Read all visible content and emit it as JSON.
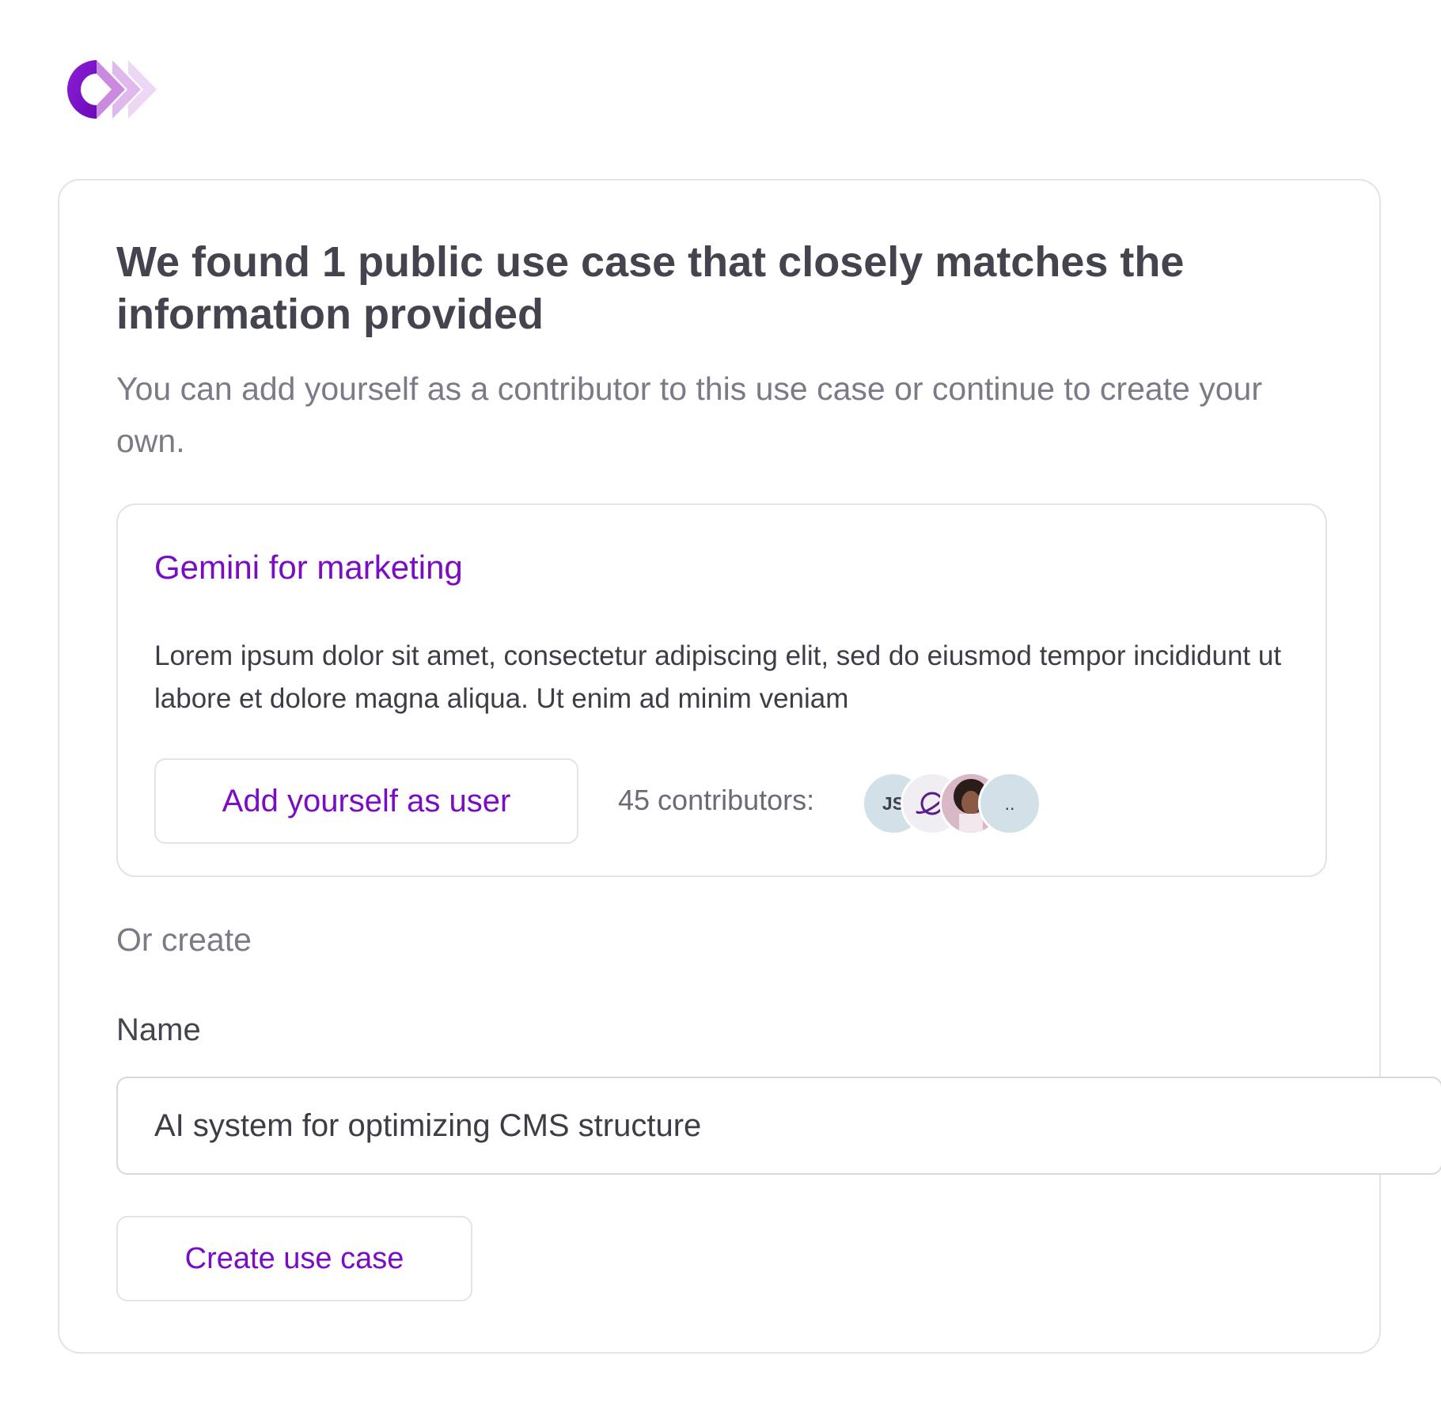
{
  "brand": {
    "logo_icon": "brand-logo-icon",
    "primary_color": "#7a0cc4",
    "accent_color": "#c98ae0"
  },
  "main": {
    "title": "We found 1 public use case that closely matches the information provided",
    "subtitle": "You can add yourself as a contributor to this use case or continue to create your own."
  },
  "match": {
    "title": "Gemini for marketing",
    "description": "Lorem ipsum dolor sit amet, consectetur adipiscing elit, sed do eiusmod tempor incididunt ut labore et dolore magna aliqua. Ut enim ad minim veniam",
    "add_button_label": "Add yourself as user",
    "contributors_label": "45 contributors:",
    "avatars": [
      {
        "type": "initials",
        "text": "JS"
      },
      {
        "type": "icon",
        "icon": "planet-icon"
      },
      {
        "type": "photo",
        "icon": "person-photo"
      },
      {
        "type": "more",
        "text": ".."
      }
    ]
  },
  "create": {
    "or_label": "Or create",
    "name_label": "Name",
    "name_value": "AI system for optimizing CMS structure",
    "create_button_label": "Create use case"
  }
}
